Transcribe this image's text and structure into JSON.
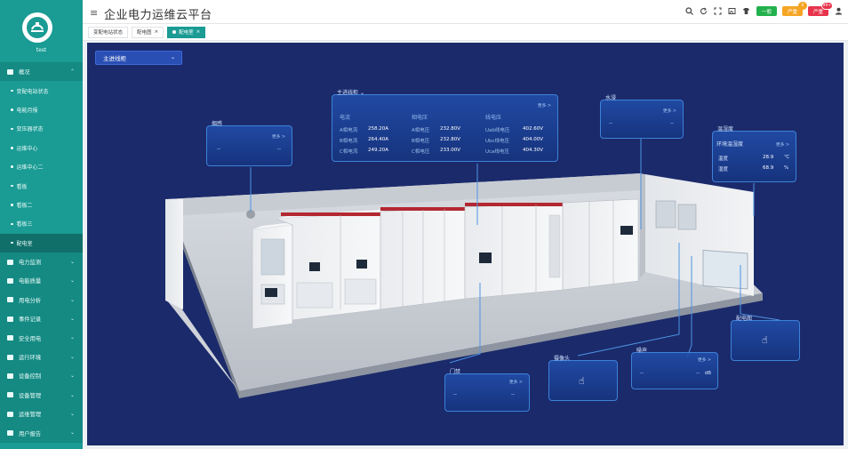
{
  "user": {
    "name": "test"
  },
  "sidebar": {
    "items": [
      {
        "label": "概况",
        "level": "top",
        "expanded": true
      },
      {
        "label": "变配电站状态",
        "level": "sub"
      },
      {
        "label": "电能月报",
        "level": "sub"
      },
      {
        "label": "变压器状态",
        "level": "sub"
      },
      {
        "label": "运维中心",
        "level": "sub"
      },
      {
        "label": "运维中心二",
        "level": "sub"
      },
      {
        "label": "看板",
        "level": "sub"
      },
      {
        "label": "看板二",
        "level": "sub"
      },
      {
        "label": "看板三",
        "level": "sub"
      },
      {
        "label": "配电室",
        "level": "sub",
        "active": true
      },
      {
        "label": "电力监测",
        "level": "top"
      },
      {
        "label": "电能质量",
        "level": "top"
      },
      {
        "label": "用电分析",
        "level": "top"
      },
      {
        "label": "事件记录",
        "level": "top"
      },
      {
        "label": "安全用电",
        "level": "top"
      },
      {
        "label": "运行环境",
        "level": "top"
      },
      {
        "label": "设备控制",
        "level": "top"
      },
      {
        "label": "设备管理",
        "level": "top"
      },
      {
        "label": "运维管理",
        "level": "top"
      },
      {
        "label": "用户报告",
        "level": "top"
      }
    ]
  },
  "header": {
    "title": "企业电力运维云平台",
    "pills": [
      {
        "label": "一般",
        "color": "#23b14d",
        "badge": ""
      },
      {
        "label": "严重",
        "color": "#f5a524",
        "badge": "0"
      },
      {
        "label": "严重",
        "color": "#e8334a",
        "badge": "99+"
      }
    ]
  },
  "tabs": [
    {
      "label": "变配电站状态",
      "active": false
    },
    {
      "label": "配电图",
      "active": false,
      "closable": true
    },
    {
      "label": "配电室",
      "active": true,
      "closable": true
    }
  ],
  "stage": {
    "selector": {
      "value": "主进线柜"
    },
    "more": "更多 >",
    "panels": {
      "smoke": {
        "title": "烟感",
        "v1": "--",
        "v2": "--"
      },
      "main": {
        "title": "主进线柜",
        "columns": [
          {
            "header": "电流",
            "rows": [
              {
                "k": "A相电流",
                "v": "258.20A"
              },
              {
                "k": "B相电流",
                "v": "264.40A"
              },
              {
                "k": "C相电流",
                "v": "249.20A"
              }
            ]
          },
          {
            "header": "相电压",
            "rows": [
              {
                "k": "A相电压",
                "v": "232.80V"
              },
              {
                "k": "B相电压",
                "v": "232.80V"
              },
              {
                "k": "C相电压",
                "v": "233.00V"
              }
            ]
          },
          {
            "header": "线电压",
            "rows": [
              {
                "k": "Uab线电压",
                "v": "402.60V"
              },
              {
                "k": "Ubc线电压",
                "v": "404.00V"
              },
              {
                "k": "Uca线电压",
                "v": "404.30V"
              }
            ]
          }
        ]
      },
      "water": {
        "title": "水浸",
        "v1": "--",
        "v2": "--"
      },
      "temp": {
        "title": "温湿度",
        "subtitle": "环境温湿度",
        "rows": [
          {
            "k": "温度",
            "v": "28.9",
            "u": "℃"
          },
          {
            "k": "湿度",
            "v": "68.9",
            "u": "%"
          }
        ]
      },
      "diagram": {
        "title": "配电图"
      },
      "camera": {
        "title": "摄像头"
      },
      "noise": {
        "title": "噪声",
        "v1": "--",
        "v2": "--",
        "u": "dB"
      },
      "door": {
        "title": "门禁",
        "v1": "--",
        "v2": "--"
      }
    }
  },
  "colors": {
    "brand": "#1a9b94",
    "stage": "#1b2a6b",
    "panel_border": "#3d82d8"
  }
}
